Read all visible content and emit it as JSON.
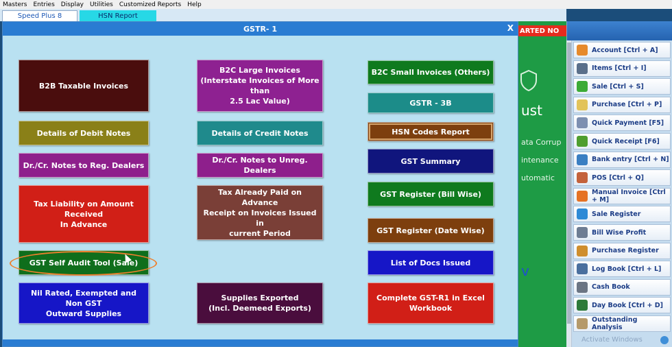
{
  "menu": [
    "Masters",
    "Entries",
    "Display",
    "Utilities",
    "Customized Reports",
    "Help"
  ],
  "tabs": [
    "Speed Plus 8",
    "HSN Report"
  ],
  "dialog": {
    "title": "GSTR- 1",
    "close": "X"
  },
  "background_app": {
    "banner": "ARTED NO",
    "lines": [
      "ust",
      "ata Corrup",
      "intenance",
      "utomatic",
      "v"
    ]
  },
  "buttons": [
    {
      "id": "b2b",
      "label": "B2B Taxable Invoices",
      "color": "#4a0d0d"
    },
    {
      "id": "b2cl",
      "label": "B2C Large Invoices\n(Interstate Invoices of More than\n2.5 Lac Value)",
      "color": "#8e2191"
    },
    {
      "id": "b2cs",
      "label": "B2C Small Invoices (Others)",
      "color": "#0f7a1e"
    },
    {
      "id": "gstr3b",
      "label": "GSTR - 3B",
      "color": "#1c8c89"
    },
    {
      "id": "hsn",
      "label": "HSN Codes Report",
      "color": "#7d3f0e"
    },
    {
      "id": "debit",
      "label": "Details of Debit Notes",
      "color": "#8a8018"
    },
    {
      "id": "credit",
      "label": "Details of Credit Notes",
      "color": "#1f8a8c"
    },
    {
      "id": "drreg",
      "label": "Dr./Cr. Notes to Reg. Dealers",
      "color": "#8e1f8c"
    },
    {
      "id": "drunreg",
      "label": "Dr./Cr. Notes to Unreg. Dealers",
      "color": "#8e1f8c"
    },
    {
      "id": "summary",
      "label": "GST Summary",
      "color": "#10157d"
    },
    {
      "id": "taxliab",
      "label": "Tax Liability on Amount Received\nIn Advance",
      "color": "#d11f17"
    },
    {
      "id": "taxpaid",
      "label": "Tax Already Paid on Advance\nReceipt on Invoices Issued in\ncurrent Period",
      "color": "#7a3f37"
    },
    {
      "id": "regbill",
      "label": "GST Register (Bill Wise)",
      "color": "#0f7a1e"
    },
    {
      "id": "regdate",
      "label": "GST Register (Date Wise)",
      "color": "#7d3f0e"
    },
    {
      "id": "audit",
      "label": "GST Self Audit Tool (Sale)",
      "color": "#0f6e1c"
    },
    {
      "id": "docs",
      "label": "List of Docs Issued",
      "color": "#1616c7"
    },
    {
      "id": "nil",
      "label": "Nil Rated, Exempted and Non GST\nOutward Supplies",
      "color": "#1616c7"
    },
    {
      "id": "exported",
      "label": "Supplies Exported\n(Incl. Deemeed Exports)",
      "color": "#4a0d3d"
    },
    {
      "id": "excel",
      "label": "Complete GST-R1 in Excel\nWorkbook",
      "color": "#d11f17"
    }
  ],
  "sidebar": [
    {
      "label": "Account [Ctrl + A]",
      "icon": "message-icon",
      "color": "#e68a2b"
    },
    {
      "label": "Items [Ctrl + I]",
      "icon": "items-icon",
      "color": "#5a6f8a"
    },
    {
      "label": "Sale [Ctrl + S]",
      "icon": "sale-icon",
      "color": "#3cab36"
    },
    {
      "label": "Purchase [Ctrl + P]",
      "icon": "purchase-icon",
      "color": "#e2c35a"
    },
    {
      "label": "Quick Payment [F5]",
      "icon": "payment-icon",
      "color": "#7d8fb0"
    },
    {
      "label": "Quick Receipt [F6]",
      "icon": "receipt-icon",
      "color": "#4f9e2e"
    },
    {
      "label": "Bank entry [Ctrl + N]",
      "icon": "bank-icon",
      "color": "#3a7fc2"
    },
    {
      "label": "POS [Ctrl + Q]",
      "icon": "pos-icon",
      "color": "#c4623b"
    },
    {
      "label": "Manual Invoice [Ctrl + M]",
      "icon": "cone-icon",
      "color": "#e57225"
    },
    {
      "label": "Sale Register",
      "icon": "globe-icon",
      "color": "#2e8ad6"
    },
    {
      "label": "Bill Wise Profit",
      "icon": "profit-icon",
      "color": "#6e7d93"
    },
    {
      "label": "Purchase Register",
      "icon": "user-icon",
      "color": "#cf8e2d"
    },
    {
      "label": "Log Book [Ctrl + L]",
      "icon": "book-icon",
      "color": "#4a6f9e"
    },
    {
      "label": "Cash Book",
      "icon": "search-icon",
      "color": "#6b7583"
    },
    {
      "label": "Day Book [Ctrl + D]",
      "icon": "daybook-icon",
      "color": "#2d7a3a"
    },
    {
      "label": "Outstanding Analysis",
      "icon": "scroll-icon",
      "color": "#b59a6a"
    }
  ],
  "watermark": "Activate Windows"
}
